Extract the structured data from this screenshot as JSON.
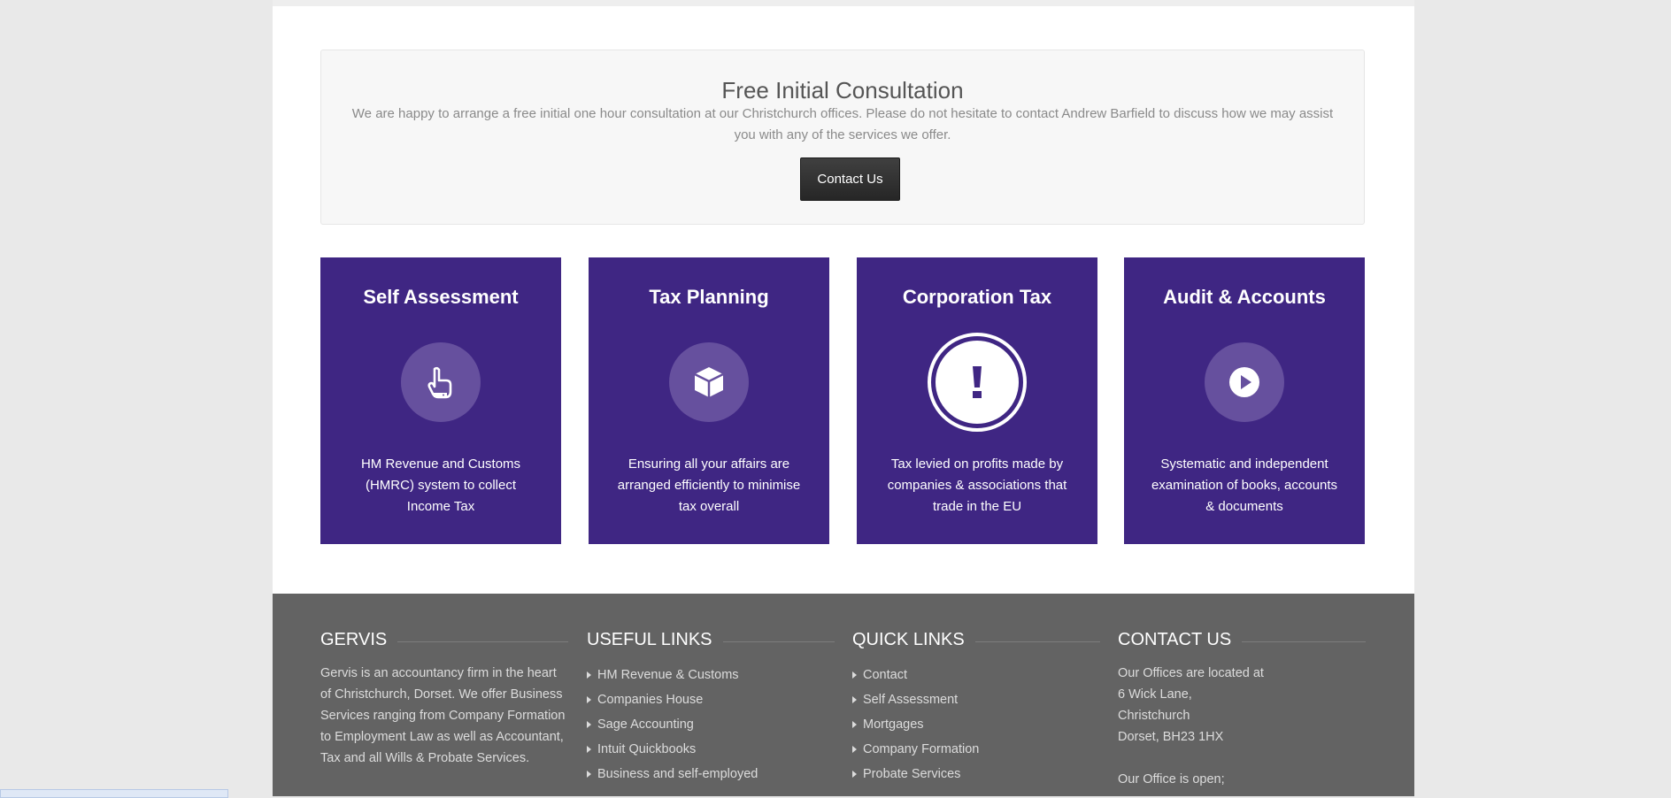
{
  "consultation": {
    "title": "Free Initial Consultation",
    "text": "We are happy to arrange a free initial one hour consultation at our Christchurch offices. Please do not hesitate to contact Andrew Barfield to discuss how we may assist you with any of the services we offer.",
    "button_label": "Contact Us"
  },
  "services": [
    {
      "title": "Self Assessment",
      "icon": "pointing-hand-icon",
      "text": "HM Revenue and Customs (HMRC) system to collect Income Tax"
    },
    {
      "title": "Tax Planning",
      "icon": "cube-icon",
      "text": "Ensuring all your affairs are arranged efficiently to minimise tax overall"
    },
    {
      "title": "Corporation Tax",
      "icon": "exclamation-icon",
      "text": "Tax levied on profits made by companies & associations that trade in the EU"
    },
    {
      "title": "Audit & Accounts",
      "icon": "play-icon",
      "text": "Systematic and independent examination of books, accounts & documents"
    }
  ],
  "footer": {
    "about": {
      "title": "GERVIS",
      "text": "Gervis is an accountancy firm in the heart of Christchurch, Dorset. We offer Business Services ranging from Company Formation to Employment Law as well as Accountant, Tax and all Wills & Probate Services."
    },
    "useful_links": {
      "title": "USEFUL LINKS",
      "items": [
        "HM Revenue & Customs",
        "Companies House",
        "Sage Accounting",
        "Intuit Quickbooks",
        "Business and self-employed"
      ]
    },
    "quick_links": {
      "title": "QUICK LINKS",
      "items": [
        "Contact",
        "Self Assessment",
        "Mortgages",
        "Company Formation",
        "Probate Services"
      ]
    },
    "contact": {
      "title": "CONTACT US",
      "intro": "Our Offices are located at",
      "address_line1": "6 Wick Lane,",
      "address_line2": "Christchurch",
      "address_line3": "Dorset, BH23 1HX",
      "hours_intro": "Our Office is open;"
    }
  },
  "colors": {
    "service_bg": "#3f2683",
    "icon_circle": "#66509e",
    "footer_bg": "#636363",
    "button_bg": "#303030"
  }
}
